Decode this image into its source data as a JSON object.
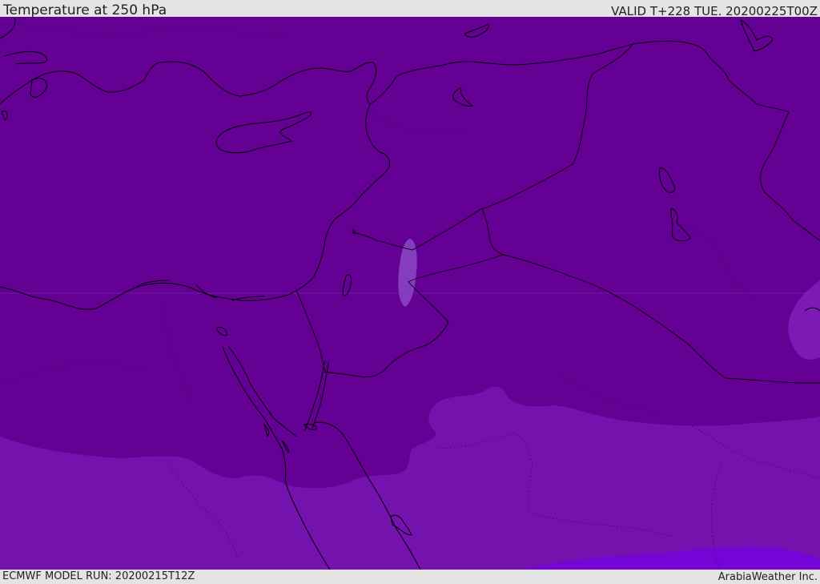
{
  "header": {
    "title": "Temperature at 250 hPa",
    "valid": "VALID T+228 TUE. 20200225T00Z"
  },
  "footer": {
    "model_run": "ECMWF MODEL RUN: 20200215T12Z",
    "credit": "ArabiaWeather Inc."
  },
  "map": {
    "variable": "Temperature",
    "level": "250 hPa",
    "region": "Eastern Mediterranean / Middle East",
    "colors": {
      "coldest_band": "#650095",
      "middle_band": "#7412ad",
      "warmer_band": "#7505d6",
      "light_patch": "#8a48c4",
      "coastline": "#000000",
      "land_boundaries_dotted": "#3c0a55"
    }
  }
}
